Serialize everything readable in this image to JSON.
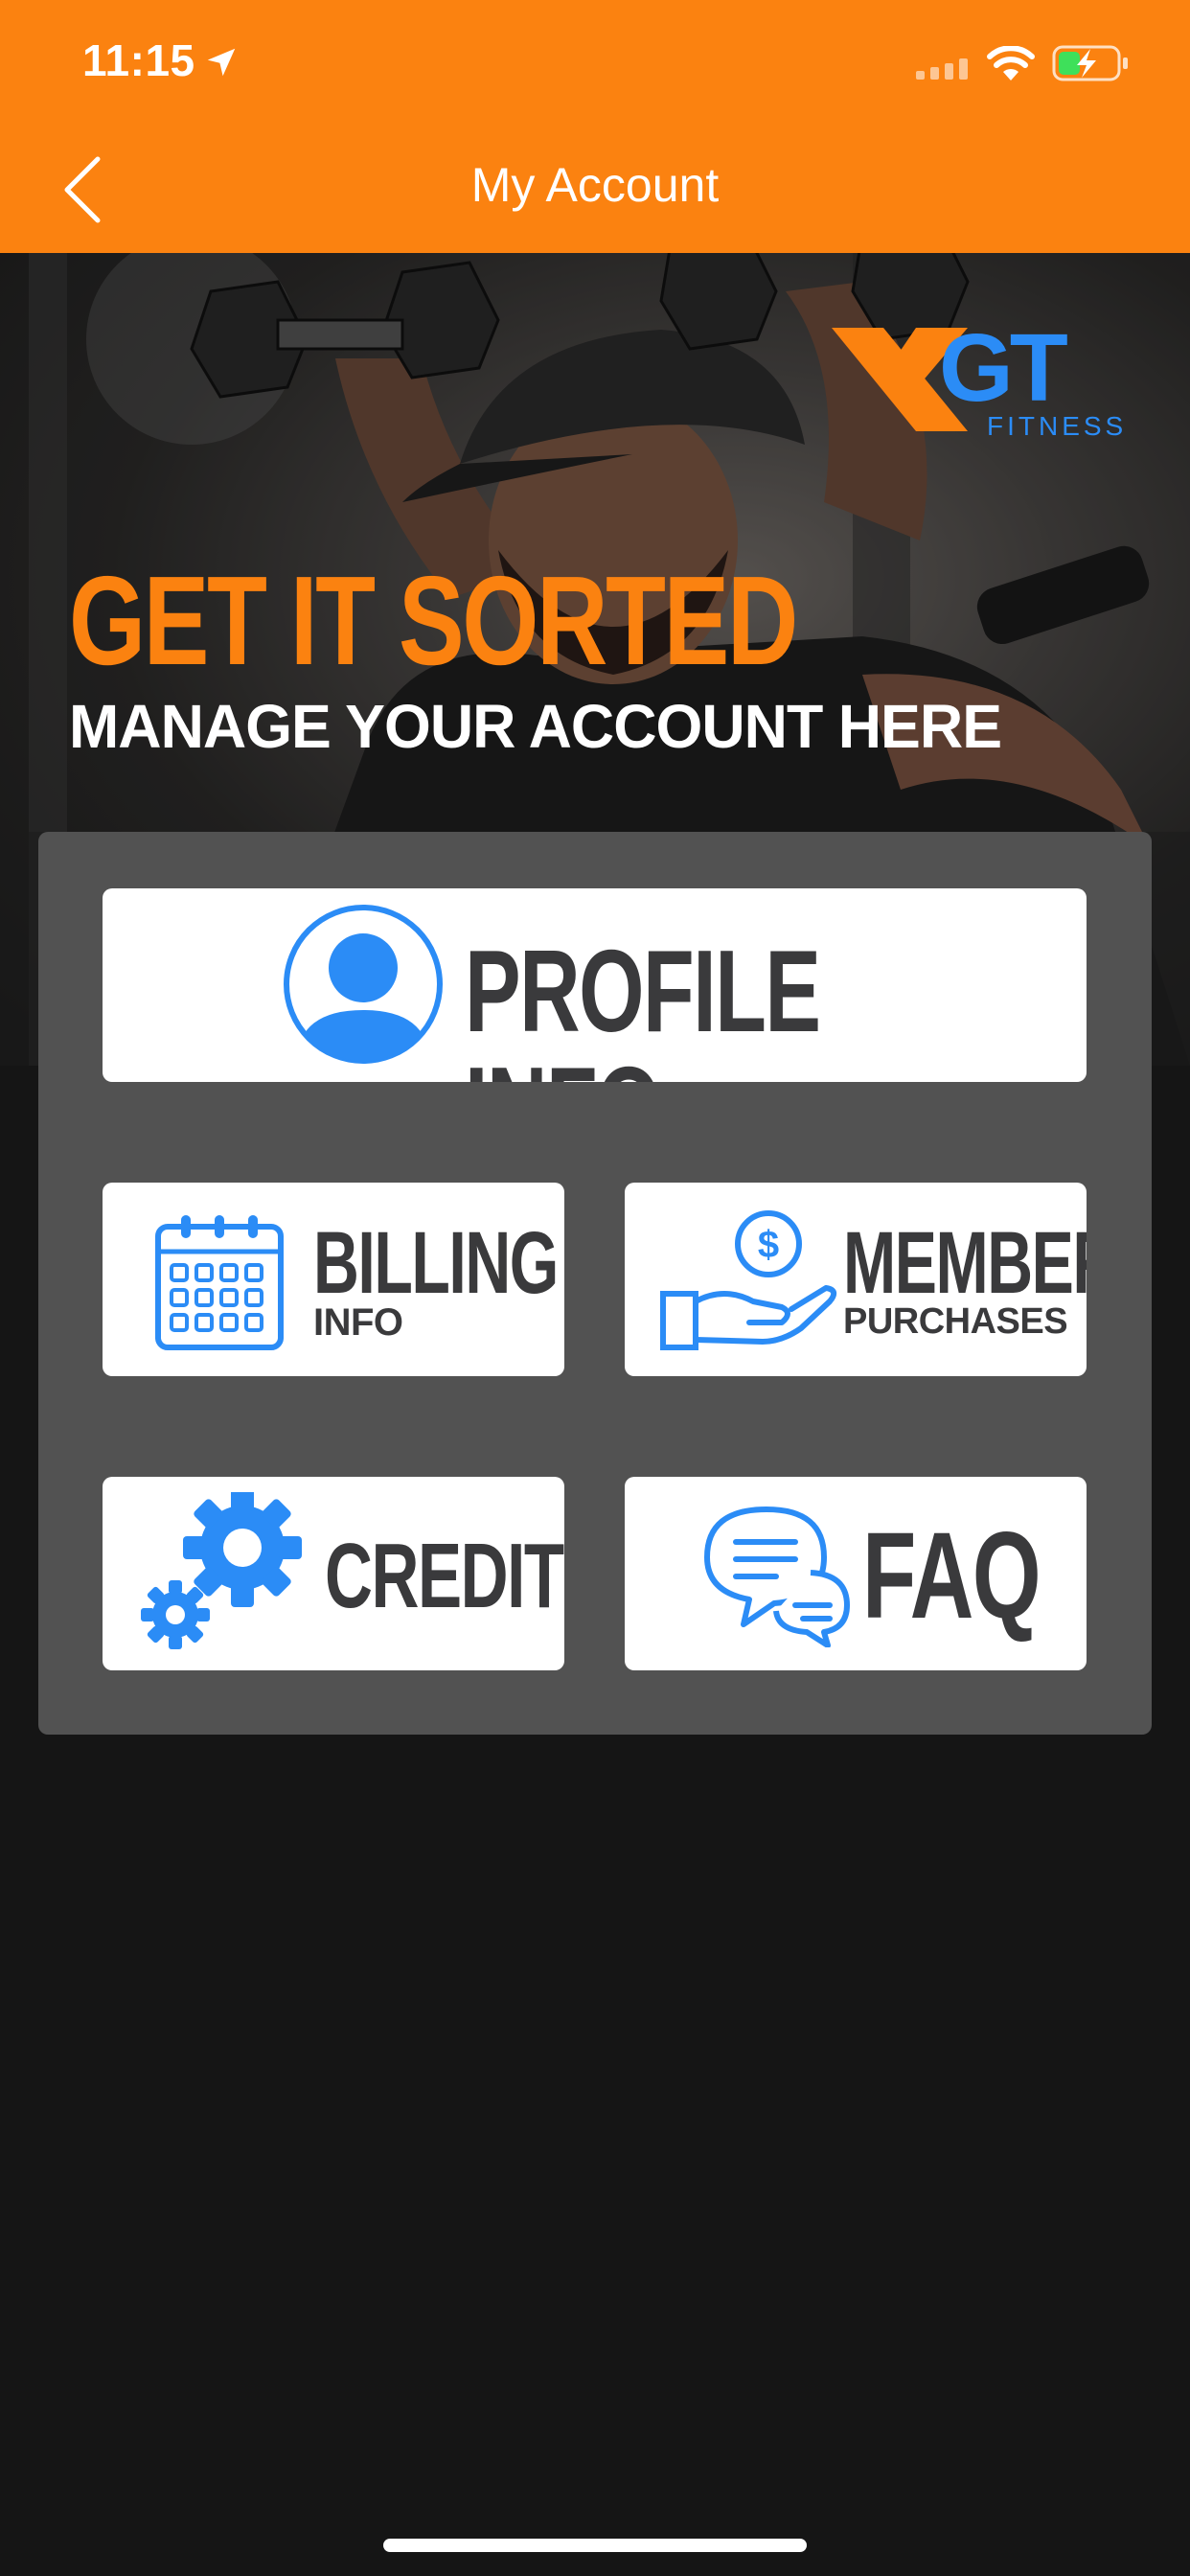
{
  "status_bar": {
    "time": "11:15"
  },
  "nav": {
    "title": "My Account",
    "back_icon": "chevron-left-icon"
  },
  "hero": {
    "logo_main": "XGT",
    "logo_sub": "FITNESS",
    "headline": "GET IT SORTED",
    "subheadline": "MANAGE YOUR ACCOUNT HERE"
  },
  "menu": {
    "profile": {
      "label": "PROFILE INFO",
      "icon": "user-icon"
    },
    "billing": {
      "label_main": "BILLING",
      "label_sub": "INFO",
      "icon": "calendar-icon"
    },
    "purchases": {
      "label_main": "MEMBER",
      "label_sub": "PURCHASES",
      "icon": "hand-dollar-icon"
    },
    "credits": {
      "label": "CREDITS",
      "icon": "gears-icon"
    },
    "faq": {
      "label": "FAQ",
      "icon": "chat-bubbles-icon"
    }
  },
  "colors": {
    "brand_orange": "#fb8210",
    "icon_blue": "#2b8cf6",
    "panel_gray": "#525252",
    "background": "#151515"
  }
}
